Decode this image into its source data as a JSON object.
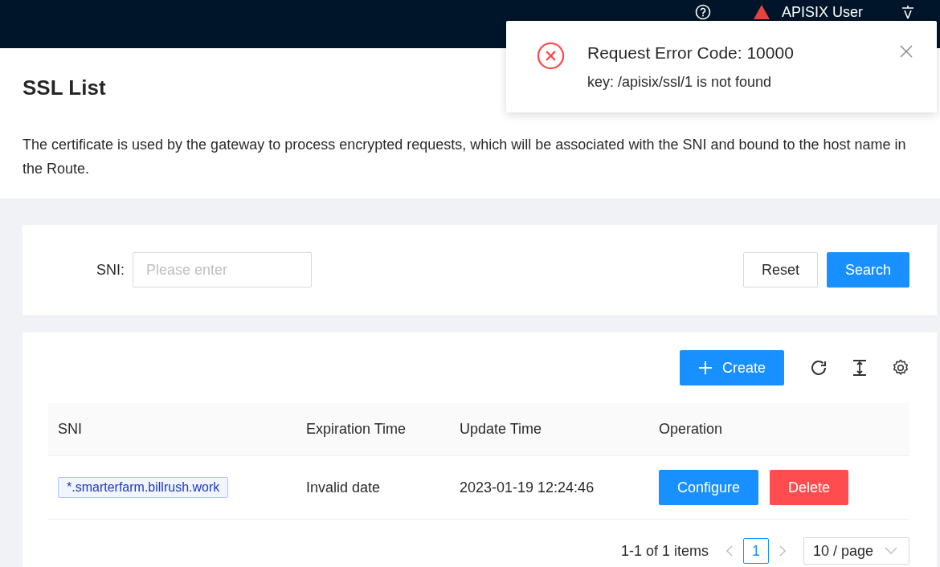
{
  "header": {
    "user": "APISIX User"
  },
  "page": {
    "title": "SSL List",
    "description": "The certificate is used by the gateway to process encrypted requests, which will be associated with the SNI and bound to the host name in the Route."
  },
  "search": {
    "label": "SNI:",
    "placeholder": "Please enter",
    "buttons": [
      {
        "label": "Reset",
        "kind": "default"
      },
      {
        "label": "Search",
        "kind": "primary"
      }
    ]
  },
  "toolbar": {
    "create": "Create"
  },
  "table": {
    "columns": [
      "SNI",
      "Expiration Time",
      "Update Time",
      "Operation"
    ],
    "rows": [
      {
        "sni": "*.smarterfarm.billrush.work",
        "expiration": "Invalid date",
        "updated": "2023-01-19 12:24:46",
        "actions": [
          {
            "label": "Configure",
            "kind": "primary"
          },
          {
            "label": "Delete",
            "kind": "danger"
          }
        ]
      }
    ]
  },
  "pagination": {
    "total": "1-1 of 1 items",
    "pages": [
      {
        "label": "1",
        "selected": true
      }
    ],
    "page_size": "10 / page"
  },
  "notification": {
    "title": "Request Error Code: 10000",
    "message": "key: /apisix/ssl/1 is not found"
  }
}
